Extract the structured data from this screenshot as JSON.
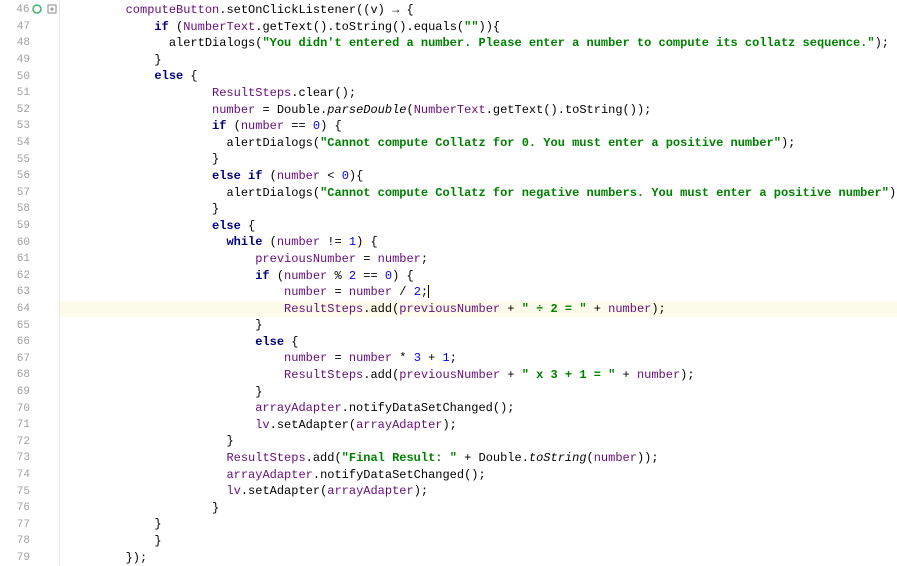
{
  "gutter": {
    "start": 46,
    "end": 79,
    "breakpoint_line": 46,
    "fold_line": 46
  },
  "highlighted_line": 64,
  "code": {
    "l46": {
      "indent": 2,
      "tokens": [
        {
          "t": "computeButton",
          "c": "purple"
        },
        {
          "t": ".",
          "c": "pu"
        },
        {
          "t": "setOnClickListener",
          "c": "mtd"
        },
        {
          "t": "((v) → {",
          "c": "pu"
        }
      ]
    },
    "l47": {
      "indent": 4,
      "tokens": [
        {
          "t": "if",
          "c": "kw"
        },
        {
          "t": " (",
          "c": "pu"
        },
        {
          "t": "NumberText",
          "c": "purple"
        },
        {
          "t": ".",
          "c": "pu"
        },
        {
          "t": "getText",
          "c": "mtd"
        },
        {
          "t": "().",
          "c": "pu"
        },
        {
          "t": "toString",
          "c": "mtd"
        },
        {
          "t": "().",
          "c": "pu"
        },
        {
          "t": "equals",
          "c": "mtd"
        },
        {
          "t": "(",
          "c": "pu"
        },
        {
          "t": "\"\"",
          "c": "str"
        },
        {
          "t": ")){",
          "c": "pu"
        }
      ]
    },
    "l48": {
      "indent": 5,
      "tokens": [
        {
          "t": "alertDialogs",
          "c": "mtd"
        },
        {
          "t": "(",
          "c": "pu"
        },
        {
          "t": "\"You didn't entered a number. Please enter a number to compute its collatz sequence.\"",
          "c": "str"
        },
        {
          "t": ");",
          "c": "pu"
        }
      ]
    },
    "l49": {
      "indent": 4,
      "tokens": [
        {
          "t": "}",
          "c": "pu"
        }
      ]
    },
    "l50": {
      "indent": 4,
      "tokens": [
        {
          "t": "else",
          "c": "kw"
        },
        {
          "t": " {",
          "c": "pu"
        }
      ]
    },
    "l51": {
      "indent": 6,
      "tokens": [
        {
          "t": "ResultSteps",
          "c": "purple"
        },
        {
          "t": ".",
          "c": "pu"
        },
        {
          "t": "clear",
          "c": "mtd"
        },
        {
          "t": "();",
          "c": "pu"
        }
      ]
    },
    "l52": {
      "indent": 6,
      "tokens": [
        {
          "t": "number",
          "c": "purple"
        },
        {
          "t": " = Double.",
          "c": "pu"
        },
        {
          "t": "parseDouble",
          "c": "static"
        },
        {
          "t": "(",
          "c": "pu"
        },
        {
          "t": "NumberText",
          "c": "purple"
        },
        {
          "t": ".",
          "c": "pu"
        },
        {
          "t": "getText",
          "c": "mtd"
        },
        {
          "t": "().",
          "c": "pu"
        },
        {
          "t": "toString",
          "c": "mtd"
        },
        {
          "t": "());",
          "c": "pu"
        }
      ]
    },
    "l53": {
      "indent": 6,
      "tokens": [
        {
          "t": "if",
          "c": "kw"
        },
        {
          "t": " (",
          "c": "pu"
        },
        {
          "t": "number",
          "c": "purple"
        },
        {
          "t": " == ",
          "c": "pu"
        },
        {
          "t": "0",
          "c": "num"
        },
        {
          "t": ") {",
          "c": "pu"
        }
      ]
    },
    "l54": {
      "indent": 7,
      "tokens": [
        {
          "t": "alertDialogs",
          "c": "mtd"
        },
        {
          "t": "(",
          "c": "pu"
        },
        {
          "t": "\"Cannot compute Collatz for 0. You must enter a positive number\"",
          "c": "str"
        },
        {
          "t": ");",
          "c": "pu"
        }
      ]
    },
    "l55": {
      "indent": 6,
      "tokens": [
        {
          "t": "}",
          "c": "pu"
        }
      ]
    },
    "l56": {
      "indent": 6,
      "tokens": [
        {
          "t": "else if",
          "c": "kw"
        },
        {
          "t": " (",
          "c": "pu"
        },
        {
          "t": "number",
          "c": "purple"
        },
        {
          "t": " < ",
          "c": "pu"
        },
        {
          "t": "0",
          "c": "num"
        },
        {
          "t": "){",
          "c": "pu"
        }
      ]
    },
    "l57": {
      "indent": 7,
      "tokens": [
        {
          "t": "alertDialogs",
          "c": "mtd"
        },
        {
          "t": "(",
          "c": "pu"
        },
        {
          "t": "\"Cannot compute Collatz for negative numbers. You must enter a positive number\"",
          "c": "str"
        },
        {
          "t": ");",
          "c": "pu"
        }
      ]
    },
    "l58": {
      "indent": 6,
      "tokens": [
        {
          "t": "}",
          "c": "pu"
        }
      ]
    },
    "l59": {
      "indent": 6,
      "tokens": [
        {
          "t": "else",
          "c": "kw"
        },
        {
          "t": " {",
          "c": "pu"
        }
      ]
    },
    "l60": {
      "indent": 7,
      "tokens": [
        {
          "t": "while",
          "c": "kw"
        },
        {
          "t": " (",
          "c": "pu"
        },
        {
          "t": "number",
          "c": "purple"
        },
        {
          "t": " != ",
          "c": "pu"
        },
        {
          "t": "1",
          "c": "num"
        },
        {
          "t": ") {",
          "c": "pu"
        }
      ]
    },
    "l61": {
      "indent": 8,
      "tokens": [
        {
          "t": "previousNumber",
          "c": "purple"
        },
        {
          "t": " = ",
          "c": "pu"
        },
        {
          "t": "number",
          "c": "purple"
        },
        {
          "t": ";",
          "c": "pu"
        }
      ]
    },
    "l62": {
      "indent": 8,
      "tokens": [
        {
          "t": "if",
          "c": "kw"
        },
        {
          "t": " (",
          "c": "pu"
        },
        {
          "t": "number",
          "c": "purple"
        },
        {
          "t": " % ",
          "c": "pu"
        },
        {
          "t": "2",
          "c": "num"
        },
        {
          "t": " == ",
          "c": "pu"
        },
        {
          "t": "0",
          "c": "num"
        },
        {
          "t": ") {",
          "c": "pu"
        }
      ]
    },
    "l63": {
      "indent": 9,
      "tokens": [
        {
          "t": "number",
          "c": "purple"
        },
        {
          "t": " = ",
          "c": "pu"
        },
        {
          "t": "number",
          "c": "purple"
        },
        {
          "t": " / ",
          "c": "pu"
        },
        {
          "t": "2",
          "c": "num"
        },
        {
          "t": ";",
          "c": "pu"
        }
      ],
      "caret": true
    },
    "l64": {
      "indent": 9,
      "tokens": [
        {
          "t": "ResultSteps",
          "c": "purple"
        },
        {
          "t": ".",
          "c": "pu"
        },
        {
          "t": "add",
          "c": "mtd"
        },
        {
          "t": "(",
          "c": "pu"
        },
        {
          "t": "previousNumber",
          "c": "purple"
        },
        {
          "t": " + ",
          "c": "pu"
        },
        {
          "t": "\" ÷ 2 = \"",
          "c": "str"
        },
        {
          "t": " + ",
          "c": "pu"
        },
        {
          "t": "number",
          "c": "purple"
        },
        {
          "t": ");",
          "c": "pu"
        }
      ]
    },
    "l65": {
      "indent": 8,
      "tokens": [
        {
          "t": "}",
          "c": "pu"
        }
      ]
    },
    "l66": {
      "indent": 8,
      "tokens": [
        {
          "t": "else",
          "c": "kw"
        },
        {
          "t": " {",
          "c": "pu"
        }
      ]
    },
    "l67": {
      "indent": 9,
      "tokens": [
        {
          "t": "number",
          "c": "purple"
        },
        {
          "t": " = ",
          "c": "pu"
        },
        {
          "t": "number",
          "c": "purple"
        },
        {
          "t": " * ",
          "c": "pu"
        },
        {
          "t": "3",
          "c": "num"
        },
        {
          "t": " + ",
          "c": "pu"
        },
        {
          "t": "1",
          "c": "num"
        },
        {
          "t": ";",
          "c": "pu"
        }
      ]
    },
    "l68": {
      "indent": 9,
      "tokens": [
        {
          "t": "ResultSteps",
          "c": "purple"
        },
        {
          "t": ".",
          "c": "pu"
        },
        {
          "t": "add",
          "c": "mtd"
        },
        {
          "t": "(",
          "c": "pu"
        },
        {
          "t": "previousNumber",
          "c": "purple"
        },
        {
          "t": " + ",
          "c": "pu"
        },
        {
          "t": "\" x 3 + 1 = \"",
          "c": "str"
        },
        {
          "t": " + ",
          "c": "pu"
        },
        {
          "t": "number",
          "c": "purple"
        },
        {
          "t": ");",
          "c": "pu"
        }
      ]
    },
    "l69": {
      "indent": 8,
      "tokens": [
        {
          "t": "}",
          "c": "pu"
        }
      ]
    },
    "l70": {
      "indent": 8,
      "tokens": [
        {
          "t": "arrayAdapter",
          "c": "purple"
        },
        {
          "t": ".",
          "c": "pu"
        },
        {
          "t": "notifyDataSetChanged",
          "c": "mtd"
        },
        {
          "t": "();",
          "c": "pu"
        }
      ]
    },
    "l71": {
      "indent": 8,
      "tokens": [
        {
          "t": "lv",
          "c": "purple"
        },
        {
          "t": ".",
          "c": "pu"
        },
        {
          "t": "setAdapter",
          "c": "mtd"
        },
        {
          "t": "(",
          "c": "pu"
        },
        {
          "t": "arrayAdapter",
          "c": "purple"
        },
        {
          "t": ");",
          "c": "pu"
        }
      ]
    },
    "l72": {
      "indent": 7,
      "tokens": [
        {
          "t": "}",
          "c": "pu"
        }
      ]
    },
    "l73": {
      "indent": 7,
      "tokens": [
        {
          "t": "ResultSteps",
          "c": "purple"
        },
        {
          "t": ".",
          "c": "pu"
        },
        {
          "t": "add",
          "c": "mtd"
        },
        {
          "t": "(",
          "c": "pu"
        },
        {
          "t": "\"Final Result: \"",
          "c": "str"
        },
        {
          "t": " + Double.",
          "c": "pu"
        },
        {
          "t": "toString",
          "c": "static"
        },
        {
          "t": "(",
          "c": "pu"
        },
        {
          "t": "number",
          "c": "purple"
        },
        {
          "t": "));",
          "c": "pu"
        }
      ]
    },
    "l74": {
      "indent": 7,
      "tokens": [
        {
          "t": "arrayAdapter",
          "c": "purple"
        },
        {
          "t": ".",
          "c": "pu"
        },
        {
          "t": "notifyDataSetChanged",
          "c": "mtd"
        },
        {
          "t": "();",
          "c": "pu"
        }
      ]
    },
    "l75": {
      "indent": 7,
      "tokens": [
        {
          "t": "lv",
          "c": "purple"
        },
        {
          "t": ".",
          "c": "pu"
        },
        {
          "t": "setAdapter",
          "c": "mtd"
        },
        {
          "t": "(",
          "c": "pu"
        },
        {
          "t": "arrayAdapter",
          "c": "purple"
        },
        {
          "t": ");",
          "c": "pu"
        }
      ]
    },
    "l76": {
      "indent": 6,
      "tokens": [
        {
          "t": "}",
          "c": "pu"
        }
      ]
    },
    "l77": {
      "indent": 4,
      "tokens": [
        {
          "t": "}",
          "c": "pu"
        }
      ]
    },
    "l78": {
      "indent": 2,
      "tokens": [
        {
          "t": "});",
          "c": "pu"
        }
      ]
    }
  },
  "indent_unit": "    ",
  "base_indent": "        "
}
